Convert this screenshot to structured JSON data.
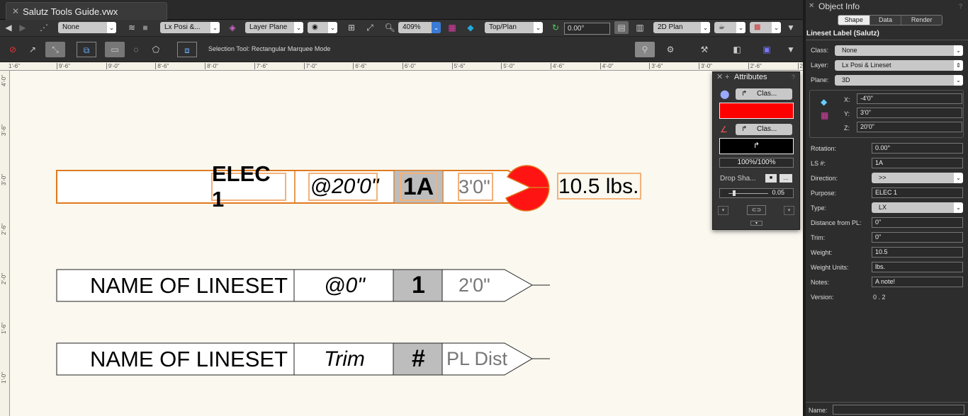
{
  "window": {
    "tab_title": "Salutz Tools Guide.vwx"
  },
  "toolbar1": {
    "class_select": "None",
    "layer_select": "Lx Posi &...",
    "layer_plane": "Layer Plane",
    "zoom": "409%",
    "view": "Top/Plan",
    "rotation": "0.00°",
    "render_mode": "2D Plan"
  },
  "toolbar2": {
    "mode_text": "Selection Tool: Rectangular Marquee Mode"
  },
  "ruler": {
    "h_ticks": [
      "9'-6\"",
      "9'-0\"",
      "8'-6\"",
      "8'-0\"",
      "7'-6\"",
      "7'-0\"",
      "6'-6\"",
      "6'-0\"",
      "5'-6\"",
      "5'-0\"",
      "4'-6\"",
      "4'-0\"",
      "3'-6\"",
      "3'-0\"",
      "2'-6\"",
      "2'-0\""
    ],
    "v_ticks": [
      "4'-0\"",
      "3'-6\"",
      "3'-0\"",
      "2'-6\"",
      "2'-0\"",
      "1'-6\"",
      "1'-0\""
    ],
    "first_h": "1'-6\""
  },
  "labels": [
    {
      "name": "ELEC 1",
      "offset": "@20'0\"",
      "ls": "1A",
      "dist": "3'0\"",
      "weight": "10.5 lbs."
    },
    {
      "name": "NAME OF LINESET",
      "offset": "@0\"",
      "ls": "1",
      "dist": "2'0\""
    },
    {
      "name": "NAME OF LINESET",
      "offset": "Trim",
      "ls": "#",
      "dist": "PL Dist"
    }
  ],
  "attributes": {
    "title": "Attributes",
    "fill_class": "Clas...",
    "pen_class": "Clas...",
    "fill_color": "#ff0000",
    "pen_color": "#000000",
    "opacity": "100%/100%",
    "drop_shadow": "Drop Sha...",
    "line_weight": "0.05"
  },
  "object_info": {
    "title": "Object Info",
    "tabs": [
      "Shape",
      "Data",
      "Render"
    ],
    "object_name": "Lineset Label (Salutz)",
    "class_label": "Class:",
    "class_value": "None",
    "layer_label": "Layer:",
    "layer_value": "Lx Posi & Lineset",
    "plane_label": "Plane:",
    "plane_value": "3D",
    "x_label": "X:",
    "x_value": "-4'0\"",
    "y_label": "Y:",
    "y_value": "3'0\"",
    "z_label": "Z:",
    "z_value": "20'0\"",
    "fields": [
      {
        "label": "Rotation:",
        "value": "0.00°",
        "type": "input"
      },
      {
        "label": "LS #:",
        "value": "1A",
        "type": "input"
      },
      {
        "label": "Direction:",
        "value": ">>",
        "type": "select"
      },
      {
        "label": "Purpose:",
        "value": "ELEC 1",
        "type": "input"
      },
      {
        "label": "Type:",
        "value": "LX",
        "type": "select"
      },
      {
        "label": "Distance from PL:",
        "value": "0\"",
        "type": "input"
      },
      {
        "label": "Trim:",
        "value": "0\"",
        "type": "input"
      },
      {
        "label": "Weight:",
        "value": "10.5",
        "type": "input"
      },
      {
        "label": "Weight Units:",
        "value": "lbs.",
        "type": "input"
      },
      {
        "label": "Notes:",
        "value": "A note!",
        "type": "input"
      },
      {
        "label": "Version:",
        "value": "0 . 2",
        "type": "text"
      }
    ],
    "name_label": "Name:"
  }
}
